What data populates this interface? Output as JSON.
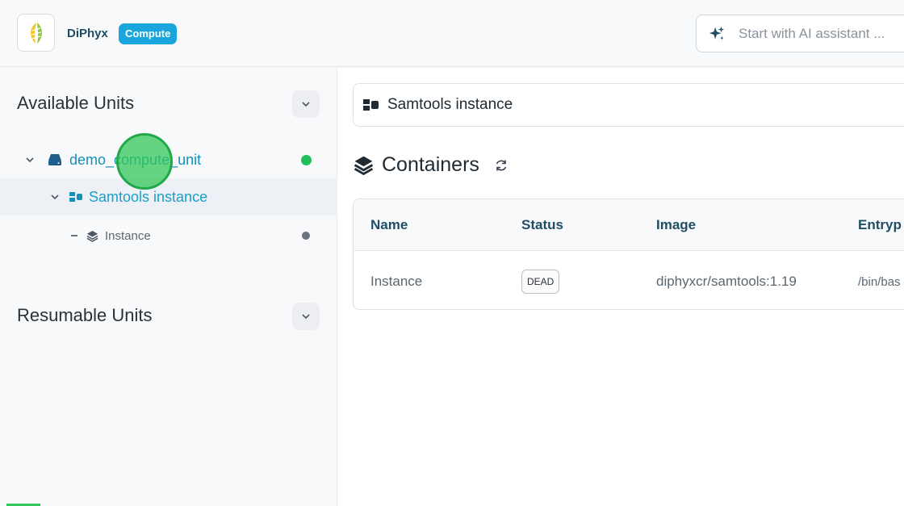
{
  "header": {
    "brand": "DiPhyx",
    "badge": "Compute",
    "ai_placeholder": "Start with AI assistant ..."
  },
  "sidebar": {
    "available_title": "Available Units",
    "resumable_title": "Resumable Units",
    "tree": {
      "unit": {
        "label": "demo_compute_unit",
        "status_color": "#1fbf5a"
      },
      "instance_group": {
        "label": "Samtools instance"
      },
      "leaf": {
        "label": "Instance",
        "status_color": "#6b7280"
      }
    }
  },
  "main": {
    "instance_title": "Samtools instance",
    "containers_title": "Containers",
    "table": {
      "headers": [
        "Name",
        "Status",
        "Image",
        "Entryp"
      ],
      "rows": [
        {
          "name": "Instance",
          "status": "DEAD",
          "image": "diphyxcr/samtools:1.19",
          "entrypoint": "/bin/bas"
        }
      ]
    }
  },
  "colors": {
    "accent": "#1aa6dd",
    "brand_text": "#1f4e63",
    "link": "#1a8fb8"
  }
}
